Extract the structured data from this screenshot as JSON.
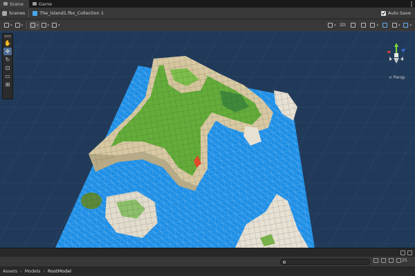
{
  "tabs": [
    {
      "label": "Scene",
      "icon": "scene-hash-icon"
    },
    {
      "label": "Game",
      "icon": "gamepad-icon"
    }
  ],
  "breadcrumb": {
    "scenes_label": "Scenes",
    "prefab_label": "The_Island1.fbx_Collection 1"
  },
  "autosave": {
    "label": "Auto Save",
    "checked": true
  },
  "toolbar": {
    "mode_2d_label": "2D"
  },
  "tools": [
    "view-tool",
    "move-tool",
    "rotate-tool",
    "scale-tool",
    "rect-tool",
    "transform-tool"
  ],
  "gizmo": {
    "projection_label": "< Persp"
  },
  "project": {
    "search_placeholder": "",
    "hidden_count": "25"
  },
  "path": {
    "items": [
      "Assets",
      "Models",
      "RootModel"
    ]
  },
  "colors": {
    "sky": "#213a59",
    "water": "#1f8fe6",
    "grass": "#64ad3a",
    "sand": "#d8c9a3",
    "accent": "#4d6d96"
  }
}
